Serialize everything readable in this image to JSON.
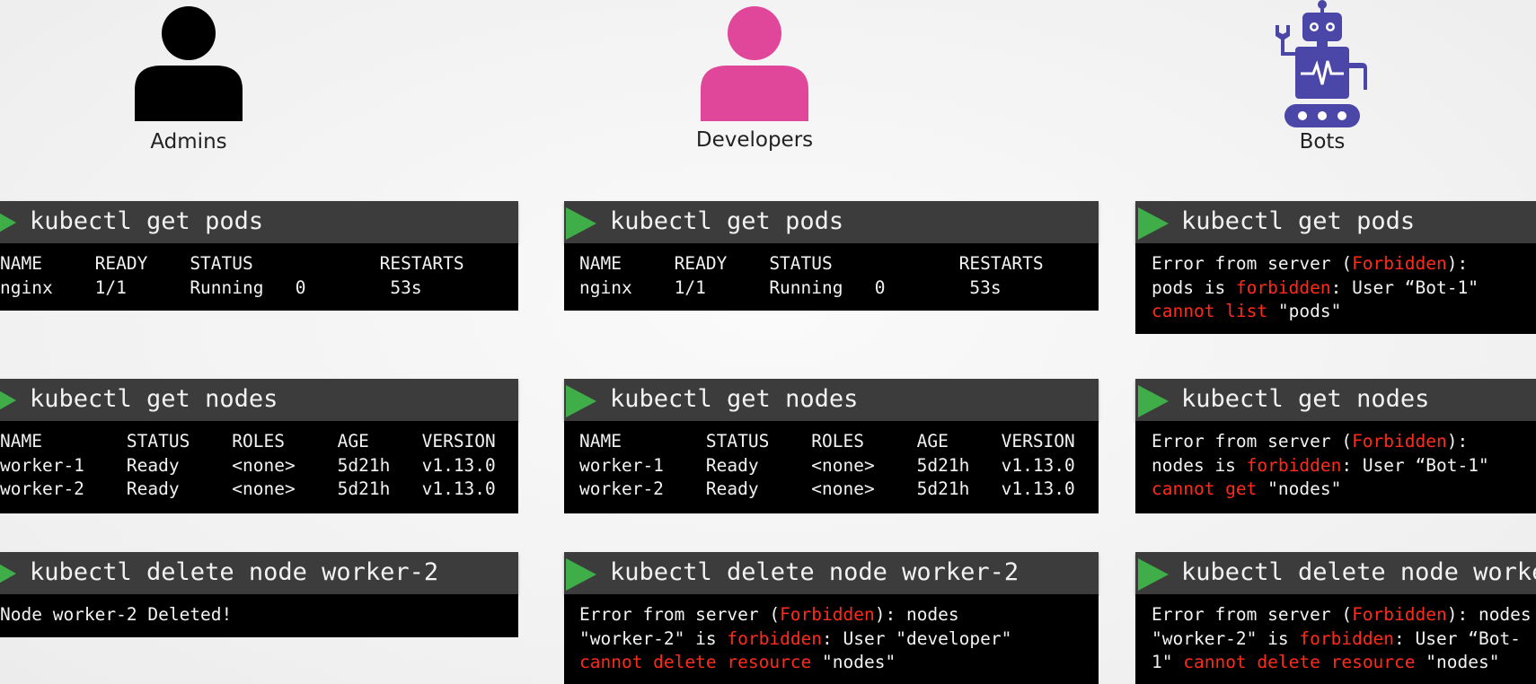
{
  "personas": {
    "admins": {
      "label": "Admins",
      "color": "#000000"
    },
    "developers": {
      "label": "Developers",
      "color": "#e0479a"
    },
    "bots": {
      "label": "Bots",
      "color": "#4b47a8"
    }
  },
  "commands": {
    "get_pods": "kubectl get pods",
    "get_nodes": "kubectl get nodes",
    "delete_node": "kubectl delete node worker-2"
  },
  "columns": {
    "admins": {
      "pods": {
        "header": "NAME     READY    STATUS            RESTARTS",
        "row1": "nginx    1/1      Running   0        53s"
      },
      "nodes": {
        "header": "NAME        STATUS    ROLES     AGE     VERSION",
        "row1": "worker-1    Ready     <none>    5d21h   v1.13.0",
        "row2": "worker-2    Ready     <none>    5d21h   v1.13.0"
      },
      "delete": {
        "line1": "Node worker-2 Deleted!"
      }
    },
    "developers": {
      "pods": {
        "header": "NAME     READY    STATUS            RESTARTS",
        "row1": "nginx    1/1      Running   0        53s"
      },
      "nodes": {
        "header": "NAME        STATUS    ROLES     AGE     VERSION",
        "row1": "worker-1    Ready     <none>    5d21h   v1.13.0",
        "row2": "worker-2    Ready     <none>    5d21h   v1.13.0"
      },
      "delete": {
        "l1a": "Error from server (",
        "l1b": "Forbidden",
        "l1c": "): nodes",
        "l2a": "\"worker-2\" is ",
        "l2b": "forbidden",
        "l2c": ": User \"developer\"",
        "l3a": "cannot delete resource",
        "l3b": " \"nodes\""
      }
    },
    "bots": {
      "pods": {
        "l1a": "Error from server (",
        "l1b": "Forbidden",
        "l1c": "):",
        "l2a": "pods is ",
        "l2b": "forbidden",
        "l2c": ": User “Bot-1\"",
        "l3a": "cannot list",
        "l3b": " \"pods\""
      },
      "nodes": {
        "l1a": "Error from server (",
        "l1b": "Forbidden",
        "l1c": "):",
        "l2a": "nodes is ",
        "l2b": "forbidden",
        "l2c": ": User “Bot-1\"",
        "l3a": "cannot get",
        "l3b": " \"nodes\""
      },
      "delete": {
        "l1a": "Error from server (",
        "l1b": "Forbidden",
        "l1c": "): nodes",
        "l2a": "\"worker-2\" is ",
        "l2b": "forbidden",
        "l2c": ": User “Bot-",
        "l3a": "1\" ",
        "l3b": "cannot delete resource",
        "l3c": " \"nodes\""
      }
    }
  },
  "colors": {
    "error_red": "#ff2a1a",
    "play_green": "#3fae49",
    "header_bg": "#3c3c3c"
  }
}
